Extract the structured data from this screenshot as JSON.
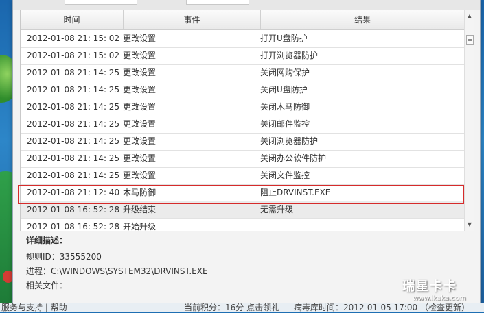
{
  "table": {
    "headers": [
      "时间",
      "事件",
      "结果"
    ],
    "rows": [
      {
        "time": "2012-01-08 21: 15: 02",
        "event": "更改设置",
        "result": "打开U盘防护"
      },
      {
        "time": "2012-01-08 21: 15: 02",
        "event": "更改设置",
        "result": "打开浏览器防护"
      },
      {
        "time": "2012-01-08 21: 14: 25",
        "event": "更改设置",
        "result": "关闭网购保护"
      },
      {
        "time": "2012-01-08 21: 14: 25",
        "event": "更改设置",
        "result": "关闭U盘防护"
      },
      {
        "time": "2012-01-08 21: 14: 25",
        "event": "更改设置",
        "result": "关闭木马防御"
      },
      {
        "time": "2012-01-08 21: 14: 25",
        "event": "更改设置",
        "result": "关闭邮件监控"
      },
      {
        "time": "2012-01-08 21: 14: 25",
        "event": "更改设置",
        "result": "关闭浏览器防护"
      },
      {
        "time": "2012-01-08 21: 14: 25",
        "event": "更改设置",
        "result": "关闭办公软件防护"
      },
      {
        "time": "2012-01-08 21: 14: 25",
        "event": "更改设置",
        "result": "关闭文件监控"
      },
      {
        "time": "2012-01-08 21: 12: 40",
        "event": "木马防御",
        "result": "阻止DRVINST.EXE"
      },
      {
        "time": "2012-01-08 16: 52: 28",
        "event": "升级结束",
        "result": "无需升级"
      },
      {
        "time": "2012-01-08 16: 52: 28",
        "event": "开始升级",
        "result": ""
      }
    ],
    "selected_index": 9
  },
  "detail": {
    "title": "详细描述：",
    "rule_id": "规则ID：33555200",
    "process": "进程：C:\\WINDOWS\\SYSTEM32\\DRVINST.EXE",
    "files": "相关文件："
  },
  "statusbar": {
    "left": "服务与支持 | 帮助",
    "middle": "当前积分：16分 点击领礼",
    "right": "病毒库时间：2012-01-05 17:00 （检查更新）"
  },
  "watermark": {
    "name": "瑞星卡卡",
    "url": "www.ikaka.com"
  },
  "icons": {
    "scroll_up": "scroll-up-arrow-icon",
    "scroll_down": "scroll-down-arrow-icon"
  },
  "colors": {
    "highlight": "#d62b2b"
  }
}
